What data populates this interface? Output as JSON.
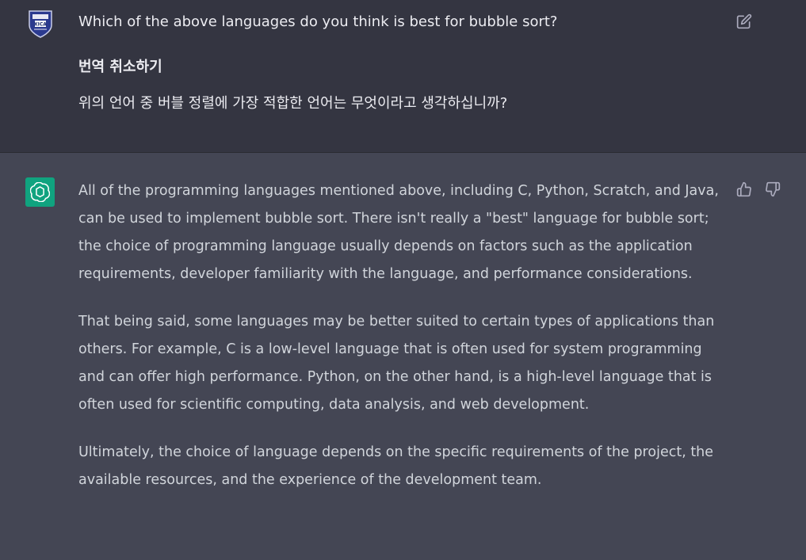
{
  "user_message": {
    "avatar_label": "XICA",
    "question": "Which of the above languages do you think is best for bubble sort?",
    "translate_cancel_label": "번역 취소하기",
    "translation": "위의 언어 중 버블 정렬에 가장 적합한 언어는 무엇이라고 생각하십니까?",
    "edit_icon": "edit-icon"
  },
  "assistant_message": {
    "avatar_icon": "openai-logo-icon",
    "avatar_color": "#10a37f",
    "paragraphs": [
      "All of the programming languages mentioned above, including C, Python, Scratch, and Java, can be used to implement bubble sort. There isn't really a \"best\" language for bubble sort; the choice of programming language usually depends on factors such as the application requirements, developer familiarity with the language, and performance considerations.",
      "That being said, some languages may be better suited to certain types of applications than others. For example, C is a low-level language that is often used for system programming and can offer high performance. Python, on the other hand, is a high-level language that is often used for scientific computing, data analysis, and web development.",
      "Ultimately, the choice of language depends on the specific requirements of the project, the available resources, and the experience of the development team."
    ],
    "feedback_icons": [
      "thumbs-up-icon",
      "thumbs-down-icon"
    ]
  },
  "colors": {
    "user_bg": "#343541",
    "assistant_bg": "#444654",
    "text": "#d1d5db"
  }
}
